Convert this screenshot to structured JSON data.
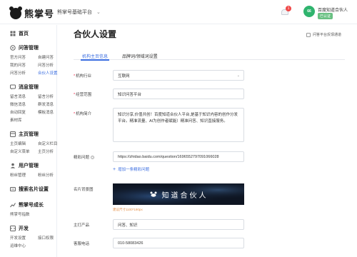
{
  "brand": {
    "name": "熊掌号",
    "platform": "熊掌号基础平台"
  },
  "header": {
    "notification_count": "1",
    "account_name": "百度知道合伙人",
    "account_badge": "已认证",
    "avatar_text": "66"
  },
  "sidebar": {
    "home": "首页",
    "groups": [
      {
        "title": "问答管理",
        "items": [
          "官方问答",
          "自建问答",
          "我的问答",
          "问答分析",
          "问答分析",
          "合伙人设置"
        ]
      },
      {
        "title": "消息管理",
        "items": [
          "留言消息",
          "留言分析",
          "微信消息",
          "群发消息",
          "自动回复",
          "模板消息",
          "素材库"
        ]
      },
      {
        "title": "主页管理",
        "items": [
          "主页编辑",
          "自定义栏目",
          "自定义菜单",
          "主页分析"
        ]
      },
      {
        "title": "用户管理",
        "items": [
          "粉丝管理",
          "粉丝分析"
        ]
      },
      {
        "title": "搜索名片设置",
        "items": []
      },
      {
        "title": "熊掌号成长",
        "items": [
          "熊掌号指数"
        ]
      },
      {
        "title": "开发",
        "items": [
          "开发设置",
          "接口权限",
          "运维中心"
        ]
      }
    ]
  },
  "main": {
    "title": "合伙人设置",
    "feedback": "问答平台反馈通道",
    "tabs": [
      "机构主页信息",
      "品牌词/领域词设置"
    ],
    "form": {
      "industry_label": "机构行业",
      "industry_value": "互联网",
      "scope_label": "经营范围",
      "scope_value": "知识问答平台",
      "intro_label": "机构简介",
      "intro_value": "知识分享,价值共创！百度知道合伙人平台,是基于知识内容的创作分发平台。精准流量、AI为创作者赋能）精准问答、知识直接服务。",
      "link_label": "精彩问题",
      "link_value": "https://zhidao.baidu.com/question/1696552797091066028",
      "add_link": "增加一条精彩问题",
      "banner_label": "名片背景图",
      "banner_text": "知道合伙人",
      "banner_hint": "建议尺寸1100*190px",
      "product_label": "主打产品",
      "product_value": "问答、知识",
      "phone_label": "客服电话",
      "phone_value": "010-58083426"
    }
  }
}
